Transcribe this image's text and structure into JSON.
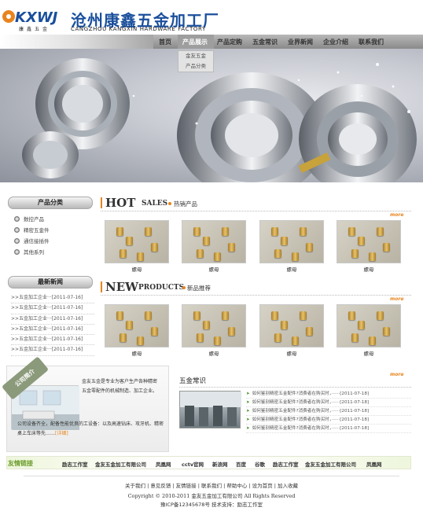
{
  "header": {
    "logo_text": "KXWJ",
    "logo_sub": "康鑫五金",
    "title": "沧州康鑫五金加工厂",
    "title_en": "CANGZHOU KANGXIN HARDWARE FACTORY"
  },
  "nav": {
    "items": [
      "首页",
      "产品展示",
      "产品定购",
      "五金常识",
      "业界新闻",
      "企业介绍",
      "联系我们"
    ],
    "active_index": 1,
    "dropdown": [
      "金友五金",
      "产品分类"
    ]
  },
  "banner": {
    "icon": "bearing-photo"
  },
  "sidebar": {
    "category_title": "产品分类",
    "categories": [
      "数控产品",
      "精密五金件",
      "通信接插件",
      "其他系列"
    ],
    "news_title": "最新新闻",
    "news": [
      ">>五金加工企业···[2011-07-16]",
      ">>五金加工企业···[2011-07-16]",
      ">>五金加工企业···[2011-07-16]",
      ">>五金加工企业···[2011-07-16]",
      ">>五金加工企业···[2011-07-16]",
      ">>五金加工企业···[2011-07-16]"
    ]
  },
  "hot": {
    "big": "HOT",
    "small": "SALES",
    "cn": "热销产品",
    "more": "more",
    "products": [
      "螺母",
      "螺母",
      "螺母",
      "螺母"
    ]
  },
  "new": {
    "big": "NEW",
    "small": "PRODUCTS",
    "cn": "新品推荐",
    "more": "more",
    "products": [
      "螺母",
      "螺母",
      "螺母",
      "螺母"
    ]
  },
  "about": {
    "tab": "公司简介",
    "p1": "金友五金是专业为客户生产各种精密五金零配件的机械制造、加工企业。",
    "p2": "公司设备齐全，配备性能优良的工设备：以及高速钻床、攻牙机、精密桌上车床等先……",
    "detail": "[详细]"
  },
  "knowledge": {
    "title": "五金常识",
    "more": "more",
    "items": [
      "如何鉴别精密五金配件?消费者在购买时，······[2011-07-18]",
      "如何鉴别精密五金配件?消费者在购买时，······[2011-07-18]",
      "如何鉴别精密五金配件?消费者在购买时，······[2011-07-18]",
      "如何鉴别精密五金配件?消费者在购买时，······[2011-07-18]",
      "如何鉴别精密五金配件?消费者在购买时，······[2011-07-18]"
    ]
  },
  "links": {
    "label": "友情链接",
    "items": [
      "励志工作室",
      "金友五金加工有限公司",
      "凤凰网",
      "cctv官网",
      "新浪网",
      "百度",
      "谷歌",
      "励志工作室",
      "金友五金加工有限公司",
      "凤凰网"
    ]
  },
  "footer": {
    "nav": "关于我们 | 意见反馈 | 友情链接 | 联系我们 | 帮助中心 | 设为首页 | 加入收藏",
    "copyright": "Copyright © 2010-2011 金友五金加工有限公司 All Rights Reserved",
    "icp": "豫ICP备12345678号  技术支持：励志工作室"
  },
  "colors": {
    "accent": "#e8841e",
    "brand": "#1a4f9c",
    "link_green": "#6b9c2a"
  }
}
